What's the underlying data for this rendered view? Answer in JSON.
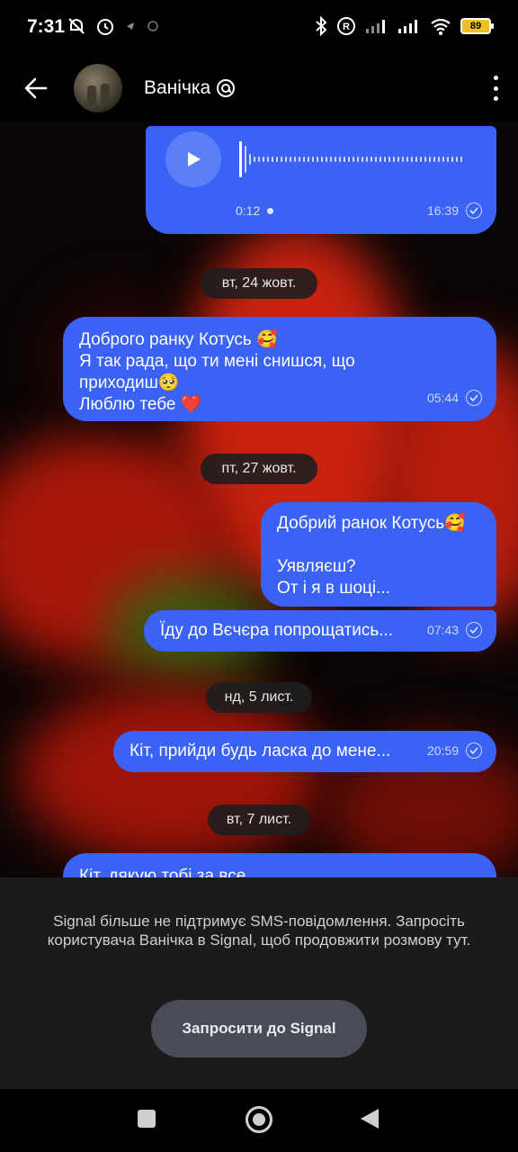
{
  "status_bar": {
    "time": "7:31",
    "battery": "89",
    "left_icons": [
      "muted-icon",
      "alarm-icon",
      "location-icon",
      "sync-icon"
    ],
    "right_icons": [
      "bluetooth-icon",
      "roaming-icon",
      "signal-icon",
      "signal-icon",
      "wifi-icon",
      "battery-icon"
    ]
  },
  "header": {
    "contact_name": "Ванічка",
    "badge_icon": "signal-at-icon",
    "back_icon": "arrow-left-icon",
    "menu_icon": "more-vertical-icon"
  },
  "voice_message": {
    "duration": "0:12",
    "time": "16:39"
  },
  "dates": {
    "d1": "вт, 24 жовт.",
    "d2": "пт, 27 жовт.",
    "d3": "нд, 5 лист.",
    "d4": "вт, 7 лист."
  },
  "messages": {
    "m1": {
      "lines": [
        "Доброго ранку Котусь 🥰",
        "Я так рада,  що ти мені снишся, що",
        "приходиш🥺",
        "Люблю тебе ❤️"
      ],
      "time": "05:44"
    },
    "m2": {
      "lines": [
        "Добрий ранок Котусь🥰",
        "",
        "Уявляєш?",
        "От і я в шоці..."
      ]
    },
    "m3": {
      "text": "Їду до Вєчєра попрощатись...",
      "time": "07:43"
    },
    "m4": {
      "text": "Кіт, прийди будь ласка до мене...",
      "time": "20:59"
    },
    "m5": {
      "text": "Кіт, дякую тобі за все"
    }
  },
  "sms_panel": {
    "notice": "Signal більше не підтримує SMS-повідомлення. Запросіть користувача Ванічка в Signal, щоб продовжити розмову тут.",
    "invite_button": "Запросити до Signal"
  },
  "colors": {
    "bubble": "#3a62f4",
    "background": "#000000",
    "panel": "#1b1b1b"
  }
}
